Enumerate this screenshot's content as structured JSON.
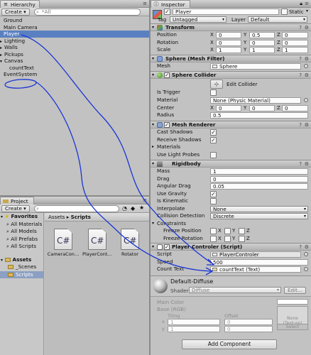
{
  "hierarchy": {
    "tab_label": "Hierarchy",
    "create_label": "Create ▾",
    "search_placeholder": "*All",
    "items": [
      {
        "label": "Ground",
        "indent": 0,
        "selected": false
      },
      {
        "label": "Main Camera",
        "indent": 0,
        "selected": false
      },
      {
        "label": "Player",
        "indent": 0,
        "selected": true
      },
      {
        "label": "Lighting",
        "indent": 0,
        "arrow": "▸",
        "selected": false
      },
      {
        "label": "Walls",
        "indent": 0,
        "arrow": "▸",
        "selected": false
      },
      {
        "label": "Pickups",
        "indent": 0,
        "arrow": "▸",
        "selected": false
      },
      {
        "label": "Canvas",
        "indent": 0,
        "arrow": "▾",
        "selected": false
      },
      {
        "label": "countText",
        "indent": 1,
        "selected": false
      },
      {
        "label": "EventSystem",
        "indent": 0,
        "selected": false
      }
    ]
  },
  "project": {
    "tab_label": "Project",
    "create_label": "Create ▾",
    "favorites_label": "Favorites",
    "favorites": [
      "All Materials",
      "All Models",
      "All Prefabs",
      "All Scripts"
    ],
    "assets_label": "Assets",
    "asset_folders": [
      "_Scenes",
      "Scripts"
    ],
    "breadcrumb_root": "Assets",
    "breadcrumb_sep": "▸",
    "breadcrumb_current": "Scripts",
    "files": [
      {
        "label": "CameraCon…",
        "glyph": "C#"
      },
      {
        "label": "PlayerCont…",
        "glyph": "C#"
      },
      {
        "label": "Rotator",
        "glyph": "C#"
      }
    ]
  },
  "inspector": {
    "tab_label": "Inspector",
    "object_name": "Player",
    "static_label": "Static",
    "tag_label": "Tag",
    "tag_value": "Untagged",
    "layer_label": "Layer",
    "layer_value": "Default",
    "transform": {
      "title": "Transform",
      "rows": [
        {
          "label": "Position",
          "x": "0",
          "y": "0.5",
          "z": "0"
        },
        {
          "label": "Rotation",
          "x": "0",
          "y": "0",
          "z": "0"
        },
        {
          "label": "Scale",
          "x": "1",
          "y": "1",
          "z": "1"
        }
      ]
    },
    "mesh_filter": {
      "title": "Sphere (Mesh Filter)",
      "mesh_label": "Mesh",
      "mesh_value": "Sphere"
    },
    "sphere_collider": {
      "title": "Sphere Collider",
      "edit_label": "Edit Collider",
      "is_trigger_label": "Is Trigger",
      "material_label": "Material",
      "material_value": "None (Physic Material)",
      "center_label": "Center",
      "center": {
        "x": "0",
        "y": "0",
        "z": "0"
      },
      "radius_label": "Radius",
      "radius_value": "0.5"
    },
    "mesh_renderer": {
      "title": "Mesh Renderer",
      "cast_shadows_label": "Cast Shadows",
      "receive_shadows_label": "Receive Shadows",
      "materials_label": "Materials",
      "light_probes_label": "Use Light Probes"
    },
    "rigidbody": {
      "title": "Rigidbody",
      "mass_label": "Mass",
      "mass_value": "1",
      "drag_label": "Drag",
      "drag_value": "0",
      "angular_drag_label": "Angular Drag",
      "angular_drag_value": "0.05",
      "use_gravity_label": "Use Gravity",
      "is_kinematic_label": "Is Kinematic",
      "interpolate_label": "Interpolate",
      "interpolate_value": "None",
      "collision_label": "Collision Detection",
      "collision_value": "Discrete",
      "constraints_label": "Constraints",
      "freeze_pos_label": "Freeze Position",
      "freeze_rot_label": "Freeze Rotation"
    },
    "player_controller": {
      "title": "Player Controler (Script)",
      "script_label": "Script",
      "script_value": "PlayerControler",
      "speed_label": "Speed",
      "speed_value": "500",
      "count_text_label": "Count Text",
      "count_text_value": "countText (Text)"
    },
    "material": {
      "name": "Default-Diffuse",
      "shader_label": "Shader",
      "shader_value": "Diffuse",
      "edit_label": "Edit...",
      "main_color_label": "Main Color",
      "base_label": "Base (RGB)",
      "tiling_label": "Tiling",
      "offset_label": "Offset",
      "tiling_x": "1",
      "tiling_y": "1",
      "offset_x": "0",
      "offset_y": "0",
      "texture_none": "None\n(Texture)",
      "select_label": "Select"
    },
    "add_component_label": "Add Component"
  },
  "colors": {
    "selection": "#5b80c1",
    "ink": "#1a35d6"
  }
}
